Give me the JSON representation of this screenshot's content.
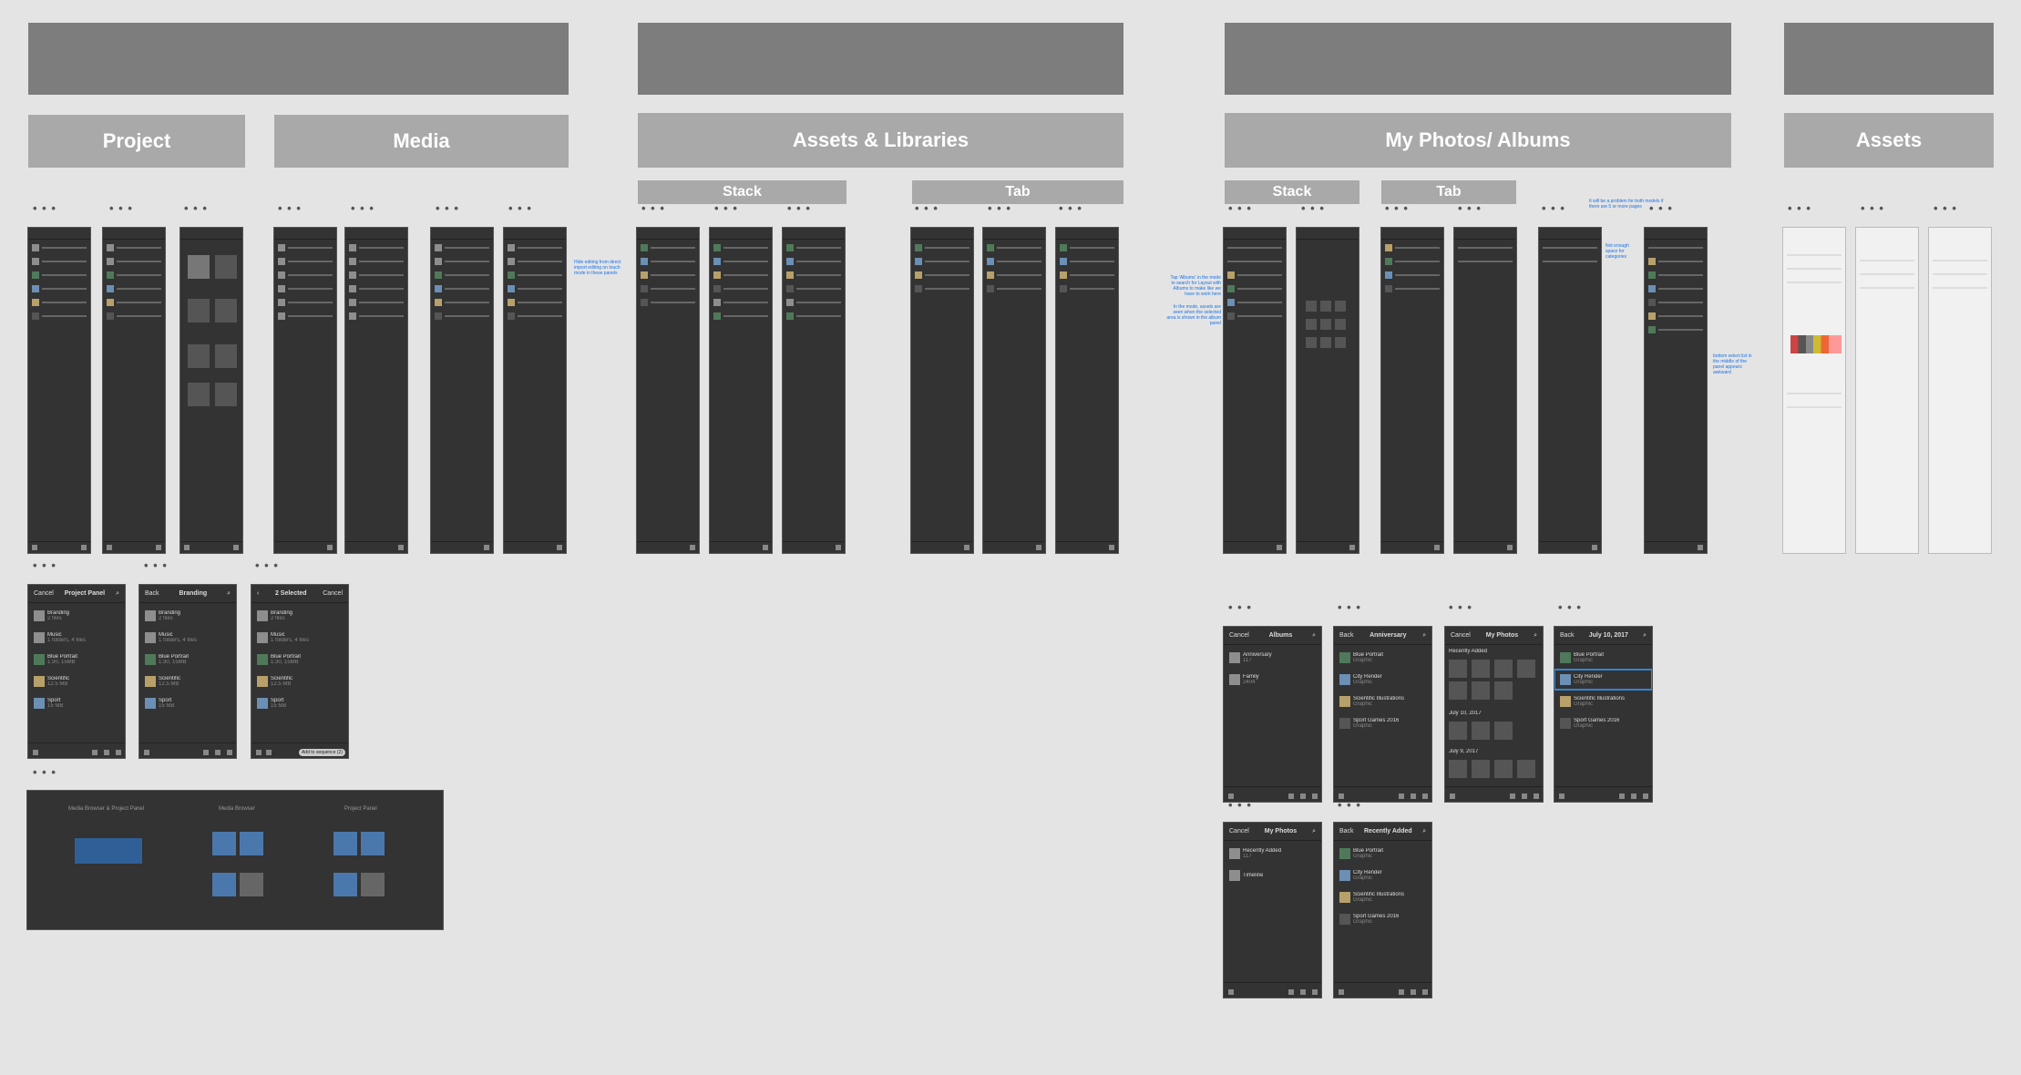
{
  "sections": {
    "project": "Project",
    "media": "Media",
    "assets_libraries": "Assets & Libraries",
    "my_photos_albums": "My Photos/ Albums",
    "assets": "Assets"
  },
  "subsections": {
    "al_stack": "Stack",
    "al_tab": "Tab",
    "mp_stack": "Stack",
    "mp_tab": "Tab"
  },
  "dots": "• • •",
  "notes": {
    "media": "Hide editing from direct import editing on touch mode in these panels",
    "photos_top": "It will be a problem for both models if there are 5 or more pages",
    "photos_space": "Not enough space for categories",
    "photos_bottom": "bottom select list in the middle of the panel appears awkward",
    "photos_left1": "Tap 'Albums' in the mode to search for Layout with Albums to make like we have to work here",
    "photos_left2": "In the mode, assets are seen when the selected area is shown in the album panel"
  },
  "project_panels": {
    "panel1": {
      "cancel": "Cancel",
      "title": "Project Panel",
      "items": [
        {
          "name": "Branding",
          "meta": "2 files"
        },
        {
          "name": "Music",
          "meta": "1 folders, 4 files"
        },
        {
          "name": "Blue Portrait",
          "meta": "1:30, 15MB"
        },
        {
          "name": "Scientific",
          "meta": "12.5 MB"
        },
        {
          "name": "Sport",
          "meta": "15 MB"
        }
      ]
    },
    "panel2": {
      "back": "Back",
      "title": "Branding",
      "items": [
        {
          "name": "Branding",
          "meta": "2 files"
        },
        {
          "name": "Music",
          "meta": "1 folders, 4 files"
        },
        {
          "name": "Blue Portrait",
          "meta": "1:30, 15MB"
        },
        {
          "name": "Scientific",
          "meta": "12.5 MB"
        },
        {
          "name": "Sport",
          "meta": "15 MB"
        }
      ]
    },
    "panel3": {
      "title": "2 Selected",
      "cancel": "Cancel",
      "items": [
        {
          "name": "Branding",
          "meta": "2 files"
        },
        {
          "name": "Music",
          "meta": "1 folders, 4 files"
        },
        {
          "name": "Blue Portrait",
          "meta": "1:30, 15MB"
        },
        {
          "name": "Scientific",
          "meta": "12.5 MB"
        },
        {
          "name": "Sport",
          "meta": "15 MB"
        }
      ],
      "action": "Add to sequence (2)"
    }
  },
  "diagram": {
    "col1": "Media Browser & Project Panel",
    "col2": "Media Browser",
    "col3": "Project Panel"
  },
  "albums_panels": {
    "albums": {
      "cancel": "Cancel",
      "title": "Albums",
      "items": [
        {
          "name": "Anniversary",
          "meta": "117"
        },
        {
          "name": "Family",
          "meta": "2404"
        }
      ]
    },
    "anniversary": {
      "back": "Back",
      "title": "Anniversary",
      "items": [
        {
          "name": "Blue Portrait",
          "meta": "Graphic"
        },
        {
          "name": "City Render",
          "meta": "Graphic"
        },
        {
          "name": "Scientific Illustrations",
          "meta": "Graphic"
        },
        {
          "name": "Sport Games 2016",
          "meta": "Graphic"
        }
      ]
    },
    "myphotos_grid": {
      "cancel": "Cancel",
      "title": "My Photos",
      "groups": [
        "Recently Added",
        "July 10, 2017",
        "July 9, 2017"
      ]
    },
    "july": {
      "back": "Back",
      "title": "July 10, 2017",
      "items": [
        {
          "name": "Blue Portrait",
          "meta": "Graphic"
        },
        {
          "name": "City Render",
          "meta": "Graphic"
        },
        {
          "name": "Scientific Illustrations",
          "meta": "Graphic"
        },
        {
          "name": "Sport Games 2016",
          "meta": "Graphic"
        }
      ]
    },
    "myphotos_list": {
      "cancel": "Cancel",
      "title": "My Photos",
      "items": [
        {
          "name": "Recently Added",
          "meta": "117"
        },
        {
          "name": "Timeline",
          "meta": ""
        }
      ]
    },
    "recent": {
      "back": "Back",
      "title": "Recently Added",
      "items": [
        {
          "name": "Blue Portrait",
          "meta": "Graphic"
        },
        {
          "name": "City Render",
          "meta": "Graphic"
        },
        {
          "name": "Scientific Illustrations",
          "meta": "Graphic"
        },
        {
          "name": "Sport Games 2016",
          "meta": "Graphic"
        }
      ]
    }
  },
  "colors": {
    "canvas": "#e4e4e4",
    "header_bar": "#7d7d7d",
    "section_header": "#a9a9a9",
    "panel_bg": "#333333",
    "accent": "#2f86d8",
    "note_text": "#1a73e8"
  }
}
